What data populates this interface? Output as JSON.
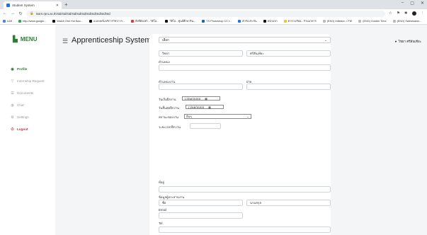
{
  "browser": {
    "tab_title": "Student System",
    "url": "learn.rpru.ac.th/std/std/std/std/std/std/std/std/std/std/std",
    "bookmarks": [
      {
        "label": "แอป",
        "color": "#4285f4"
      },
      {
        "label": "http://www.google...",
        "color": "#34a853"
      },
      {
        "label": "Watch One Hui Bao...",
        "color": "#111"
      },
      {
        "label": "แบบฟอร์มบริการวิชาการ...",
        "color": "#111"
      },
      {
        "label": "สิ่งที่ต้องทำ - วิดีโอ...",
        "color": "#e53935"
      },
      {
        "label": "วิดีโอ - ศูนย์ศึกษาจีน...",
        "color": "#111"
      },
      {
        "label": "TS Photoshop CC t...",
        "color": "#1565c0"
      },
      {
        "label": "ตัวรับประกัน",
        "color": "#1877f2"
      },
      {
        "label": "หน้าแรก",
        "color": "#111"
      },
      {
        "label": "ตารางเรียน - ร้านอาหาร",
        "color": "#fbc02d"
      },
      {
        "label": "(ENG) Inflation > PIE",
        "color": "#bbb"
      },
      {
        "label": "(ENG) Golden Time",
        "color": "#bbb"
      },
      {
        "label": "(ENG) Salesmaker...",
        "color": "#bbb"
      },
      {
        "label": "(ENG) Prince of Tennis",
        "color": "#bbb"
      },
      {
        "label": "รายการอ่าน",
        "color": "#fbc02d"
      }
    ]
  },
  "sidebar": {
    "menu_label": "MENU",
    "items": [
      {
        "label": "Profile",
        "icon": "user-icon",
        "glyph": "◉",
        "state": "active"
      },
      {
        "label": "Internship Request",
        "icon": "funnel-icon",
        "glyph": "▽",
        "state": "normal"
      },
      {
        "label": "Documents",
        "icon": "list-icon",
        "glyph": "☰",
        "state": "normal"
      },
      {
        "label": "Chat",
        "icon": "chat-icon",
        "glyph": "◍",
        "state": "normal"
      },
      {
        "label": "Settings",
        "icon": "gear-icon",
        "glyph": "⚙",
        "state": "normal"
      },
      {
        "label": "Logout",
        "icon": "power-icon",
        "glyph": "⏻",
        "state": "logout"
      }
    ]
  },
  "header": {
    "title": "Apprenticeship System",
    "user_name": "วิชยา ศรีสันเทียะ"
  },
  "form": {
    "select_value": "เลือก",
    "first_name": "วิชยา",
    "last_name": "ศรีสันเทียะ",
    "position_label": "ตำแหน่ง",
    "department_label": "ตำแหน่งงาน",
    "section_label": "ฝ่าย",
    "start_label": "วันเริ่มฝึกงาน",
    "start_value": "วว/ดด/ปปปป",
    "end_label": "วันสิ้นสุดฝึกงาน",
    "end_value": "วว/ดด/ปปปป",
    "status_label": "สถานะของงาน",
    "status_value": "อื่นๆ",
    "period_label": "ระยะเวลาฝึกงาน",
    "address_label": "ที่อยู่",
    "contact_label": "ข้อมูลผู้ประสานงาน",
    "contact_name": "ชื่อ",
    "contact_last": "นามสกุล",
    "email_label": "Email",
    "phone_label": "Tel"
  }
}
